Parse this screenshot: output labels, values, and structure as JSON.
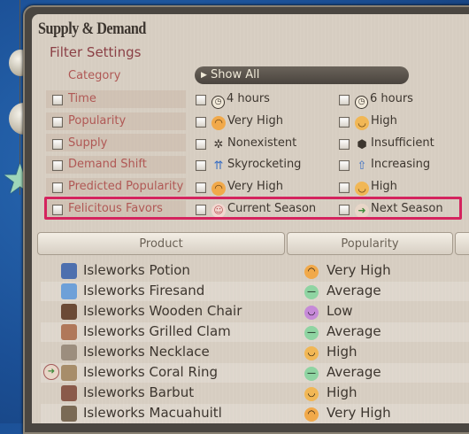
{
  "window": {
    "title": "Supply & Demand"
  },
  "filters": {
    "heading": "Filter Settings",
    "category": {
      "label": "Category",
      "value": "Show All"
    },
    "rows": [
      {
        "label": "Time",
        "opt1": "4 hours",
        "opt2": "6 hours",
        "icon1": "clock-icon",
        "icon2": "clock-icon"
      },
      {
        "label": "Popularity",
        "opt1": "Very High",
        "opt2": "High",
        "icon1": "very-high-face-icon",
        "icon2": "high-face-icon"
      },
      {
        "label": "Supply",
        "opt1": "Nonexistent",
        "opt2": "Insufficient",
        "icon1": "nonexistent-icon",
        "icon2": "box-icon"
      },
      {
        "label": "Demand Shift",
        "opt1": "Skyrocketing",
        "opt2": "Increasing",
        "icon1": "double-arrow-up-icon",
        "icon2": "arrow-up-icon"
      },
      {
        "label": "Predicted Popularity",
        "opt1": "Very High",
        "opt2": "High",
        "icon1": "very-high-face-icon",
        "icon2": "high-face-icon"
      },
      {
        "label": "Felicitous Favors",
        "opt1": "Current Season",
        "opt2": "Next Season",
        "icon1": "current-season-icon",
        "icon2": "next-season-icon"
      }
    ]
  },
  "table": {
    "headers": [
      "Product",
      "Popularity"
    ],
    "rows": [
      {
        "product": "Isleworks Potion",
        "popularity": "Very High",
        "face_color": "#f1a94a"
      },
      {
        "product": "Isleworks Firesand",
        "popularity": "Average",
        "face_color": "#8fd4a2"
      },
      {
        "product": "Isleworks Wooden Chair",
        "popularity": "Low",
        "face_color": "#c68ad8"
      },
      {
        "product": "Isleworks Grilled Clam",
        "popularity": "Average",
        "face_color": "#8fd4a2"
      },
      {
        "product": "Isleworks Necklace",
        "popularity": "High",
        "face_color": "#f1b755"
      },
      {
        "product": "Isleworks Coral Ring",
        "popularity": "Average",
        "face_color": "#8fd4a2"
      },
      {
        "product": "Isleworks Barbut",
        "popularity": "High",
        "face_color": "#f1b755"
      },
      {
        "product": "Isleworks Macuahuitl",
        "popularity": "Very High",
        "face_color": "#f1a94a"
      }
    ]
  }
}
